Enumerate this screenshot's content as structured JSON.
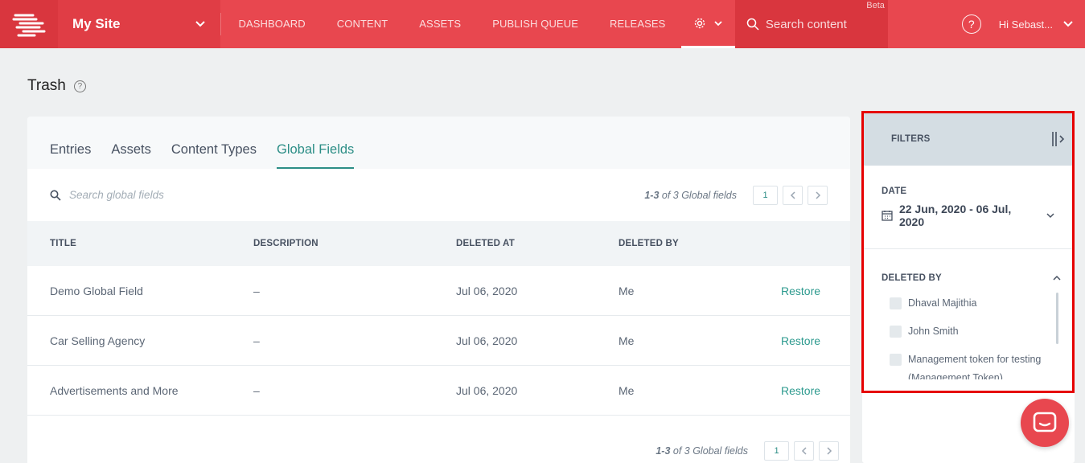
{
  "nav": {
    "site_name": "My Site",
    "links": [
      "DASHBOARD",
      "CONTENT",
      "ASSETS",
      "PUBLISH QUEUE",
      "RELEASES"
    ],
    "search_placeholder": "Search content",
    "beta_label": "Beta",
    "user_label": "Hi  Sebast..."
  },
  "page": {
    "title": "Trash"
  },
  "tabs": [
    "Entries",
    "Assets",
    "Content Types",
    "Global Fields"
  ],
  "active_tab": "Global Fields",
  "toolbar": {
    "search_placeholder": "Search global fields",
    "range": "1-3",
    "range_suffix": " of 3 Global fields",
    "page": "1"
  },
  "table": {
    "headers": [
      "TITLE",
      "DESCRIPTION",
      "DELETED AT",
      "DELETED BY"
    ],
    "rows": [
      {
        "title": "Demo Global Field",
        "description": "–",
        "deleted_at": "Jul 06, 2020",
        "deleted_by": "Me",
        "action": "Restore"
      },
      {
        "title": "Car Selling Agency",
        "description": "–",
        "deleted_at": "Jul 06, 2020",
        "deleted_by": "Me",
        "action": "Restore"
      },
      {
        "title": "Advertisements and More",
        "description": "–",
        "deleted_at": "Jul 06, 2020",
        "deleted_by": "Me",
        "action": "Restore"
      }
    ]
  },
  "filters": {
    "title": "FILTERS",
    "date_label": "DATE",
    "date_range": "22 Jun, 2020 - 06 Jul, 2020",
    "deleted_by_label": "DELETED BY",
    "users": [
      "Dhaval Majithia",
      "John Smith",
      "Management token for testing (Management Token)"
    ]
  },
  "colors": {
    "nav_bg": "#e8474f",
    "accent": "#2c8e86",
    "highlight_outline": "#e60000"
  }
}
